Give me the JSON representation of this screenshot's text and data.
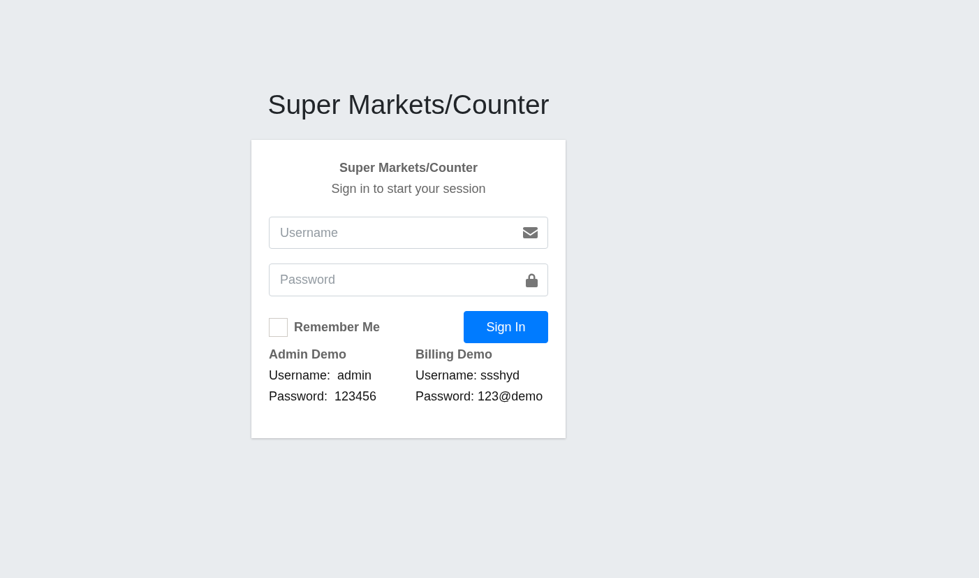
{
  "page_title": "Super Markets/Counter",
  "login_card": {
    "heading": "Super Markets/Counter",
    "subtitle": "Sign in to start your session",
    "fields": [
      {
        "kind": "email",
        "placeholder": "Username"
      },
      {
        "kind": "password",
        "placeholder": "Password"
      }
    ],
    "remember_me": {
      "label": "Remember Me",
      "checked": false
    },
    "sign_in_button": "Sign In",
    "demo_accounts": [
      {
        "title": "Admin Demo",
        "lines": [
          "Username:  admin",
          "Password:  123456"
        ]
      },
      {
        "title": "Billing Demo",
        "lines": [
          "Username: ssshyd",
          "Password: 123@demo"
        ]
      }
    ]
  }
}
